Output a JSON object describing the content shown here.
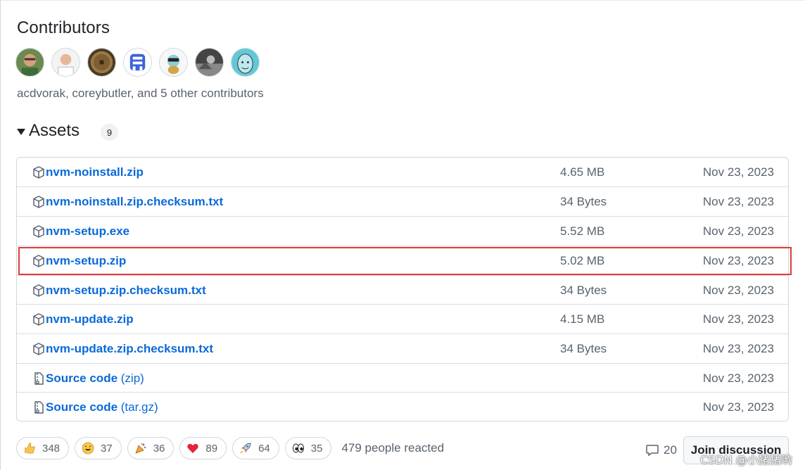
{
  "contributors": {
    "title": "Contributors",
    "summary": "acdvorak, coreybutler, and 5 other contributors",
    "avatars": [
      {
        "name": "avatar-1"
      },
      {
        "name": "avatar-2"
      },
      {
        "name": "avatar-3"
      },
      {
        "name": "avatar-4"
      },
      {
        "name": "avatar-5"
      },
      {
        "name": "avatar-6"
      },
      {
        "name": "avatar-7"
      }
    ]
  },
  "assets": {
    "title": "Assets",
    "count": "9",
    "rows": [
      {
        "name": "nvm-noinstall.zip",
        "suffix": "",
        "size": "4.65 MB",
        "date": "Nov 23, 2023",
        "icon": "package-icon"
      },
      {
        "name": "nvm-noinstall.zip.checksum.txt",
        "suffix": "",
        "size": "34 Bytes",
        "date": "Nov 23, 2023",
        "icon": "package-icon"
      },
      {
        "name": "nvm-setup.exe",
        "suffix": "",
        "size": "5.52 MB",
        "date": "Nov 23, 2023",
        "icon": "package-icon"
      },
      {
        "name": "nvm-setup.zip",
        "suffix": "",
        "size": "5.02 MB",
        "date": "Nov 23, 2023",
        "icon": "package-icon"
      },
      {
        "name": "nvm-setup.zip.checksum.txt",
        "suffix": "",
        "size": "34 Bytes",
        "date": "Nov 23, 2023",
        "icon": "package-icon"
      },
      {
        "name": "nvm-update.zip",
        "suffix": "",
        "size": "4.15 MB",
        "date": "Nov 23, 2023",
        "icon": "package-icon"
      },
      {
        "name": "nvm-update.zip.checksum.txt",
        "suffix": "",
        "size": "34 Bytes",
        "date": "Nov 23, 2023",
        "icon": "package-icon"
      },
      {
        "name": "Source code",
        "suffix": " (zip)",
        "size": "",
        "date": "Nov 23, 2023",
        "icon": "file-zip-icon"
      },
      {
        "name": "Source code",
        "suffix": " (tar.gz)",
        "size": "",
        "date": "Nov 23, 2023",
        "icon": "file-zip-icon"
      }
    ]
  },
  "reactions": {
    "items": [
      {
        "emoji": "thumbs-up-icon",
        "count": "348"
      },
      {
        "emoji": "laugh-icon",
        "count": "37"
      },
      {
        "emoji": "party-popper-icon",
        "count": "36"
      },
      {
        "emoji": "heart-icon",
        "count": "89"
      },
      {
        "emoji": "rocket-icon",
        "count": "64"
      },
      {
        "emoji": "eyes-icon",
        "count": "35"
      }
    ],
    "summary": "479 people reacted"
  },
  "discussion": {
    "comment_count": "20",
    "join_label": "Join discussion"
  },
  "watermark": "CSDN @小猪猪哟",
  "colors": {
    "link": "#0969da",
    "highlight": "#e3393a",
    "muted": "#59636e"
  }
}
